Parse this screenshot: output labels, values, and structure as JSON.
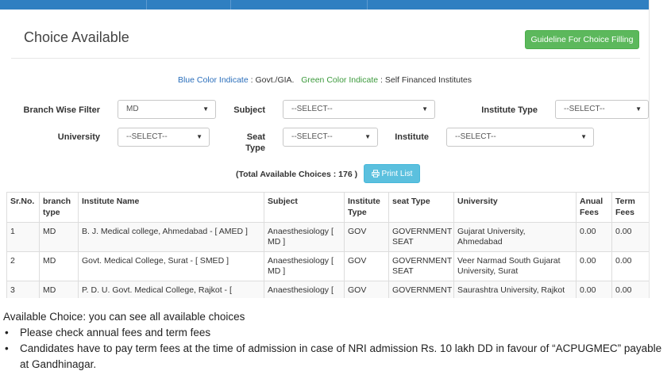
{
  "page": {
    "title": "Choice Available",
    "guideline_button": "Guideline For Choice Filling"
  },
  "legend": {
    "blue_label": "Blue Color Indicate",
    "blue_value": " : Govt./GIA.",
    "green_label": "Green Color Indicate",
    "green_value": " : Self Financed Institutes"
  },
  "filters": {
    "branch_label": "Branch Wise Filter",
    "branch_value": "MD",
    "subject_label": "Subject",
    "subject_value": "--SELECT--",
    "institute_type_label": "Institute Type",
    "institute_type_value": "--SELECT--",
    "university_label": "University",
    "university_value": "--SELECT--",
    "seat_type_label_1": "Seat",
    "seat_type_label_2": "Type",
    "seat_type_value": "--SELECT--",
    "institute_label": "Institute",
    "institute_value": "--SELECT--"
  },
  "summary": {
    "total_text": "(Total Available Choices : 176 )",
    "print_button": "Print List"
  },
  "table": {
    "headers": {
      "srno": "Sr.No.",
      "branch_1": "branch",
      "branch_2": "type",
      "institute": "Institute Name",
      "subject": "Subject",
      "itype_1": "Institute",
      "itype_2": "Type",
      "seat": "seat Type",
      "university": "University",
      "anual_1": "Anual",
      "anual_2": "Fees",
      "term_1": "Term",
      "term_2": "Fees"
    },
    "rows": [
      {
        "srno": "1",
        "branch": "MD",
        "institute": "B. J. Medical college, Ahmedabad - [ AMED ]",
        "subject_1": "Anaesthesiology [",
        "subject_2": "MD ]",
        "itype": "GOV",
        "seat_1": "GOVERNMENT",
        "seat_2": "SEAT",
        "university_1": "Gujarat University,",
        "university_2": "Ahmedabad",
        "anual": "0.00",
        "term": "0.00"
      },
      {
        "srno": "2",
        "branch": "MD",
        "institute": "Govt. Medical College, Surat - [ SMED ]",
        "subject_1": "Anaesthesiology [",
        "subject_2": "MD ]",
        "itype": "GOV",
        "seat_1": "GOVERNMENT",
        "seat_2": "SEAT",
        "university_1": "Veer Narmad South Gujarat",
        "university_2": "University, Surat",
        "anual": "0.00",
        "term": "0.00"
      },
      {
        "srno": "3",
        "branch": "MD",
        "institute": "P. D. U. Govt. Medical College, Rajkot - [",
        "subject_1": "Anaesthesiology [",
        "subject_2": "",
        "itype": "GOV",
        "seat_1": "GOVERNMENT",
        "seat_2": "",
        "university_1": "Saurashtra University, Rajkot",
        "university_2": "",
        "anual": "0.00",
        "term": "0.00"
      }
    ]
  },
  "notes": {
    "intro": "Available Choice: you can see all available choices",
    "bullets": [
      "Please check annual fees and term fees",
      "Candidates have to pay term fees at the time of admission in case of NRI admission Rs. 10 lakh DD in favour of “ACPUGMEC” payable at Gandhinagar."
    ]
  },
  "icons": {
    "print": "printer-icon",
    "caret": "caret-down-icon"
  },
  "colors": {
    "topbar": "#2f7fc1",
    "guideline_button": "#5cb85c",
    "print_button": "#5bc0de",
    "govt_indicator": "#2a6ebb",
    "self_financed_indicator": "#3c9a3c"
  }
}
